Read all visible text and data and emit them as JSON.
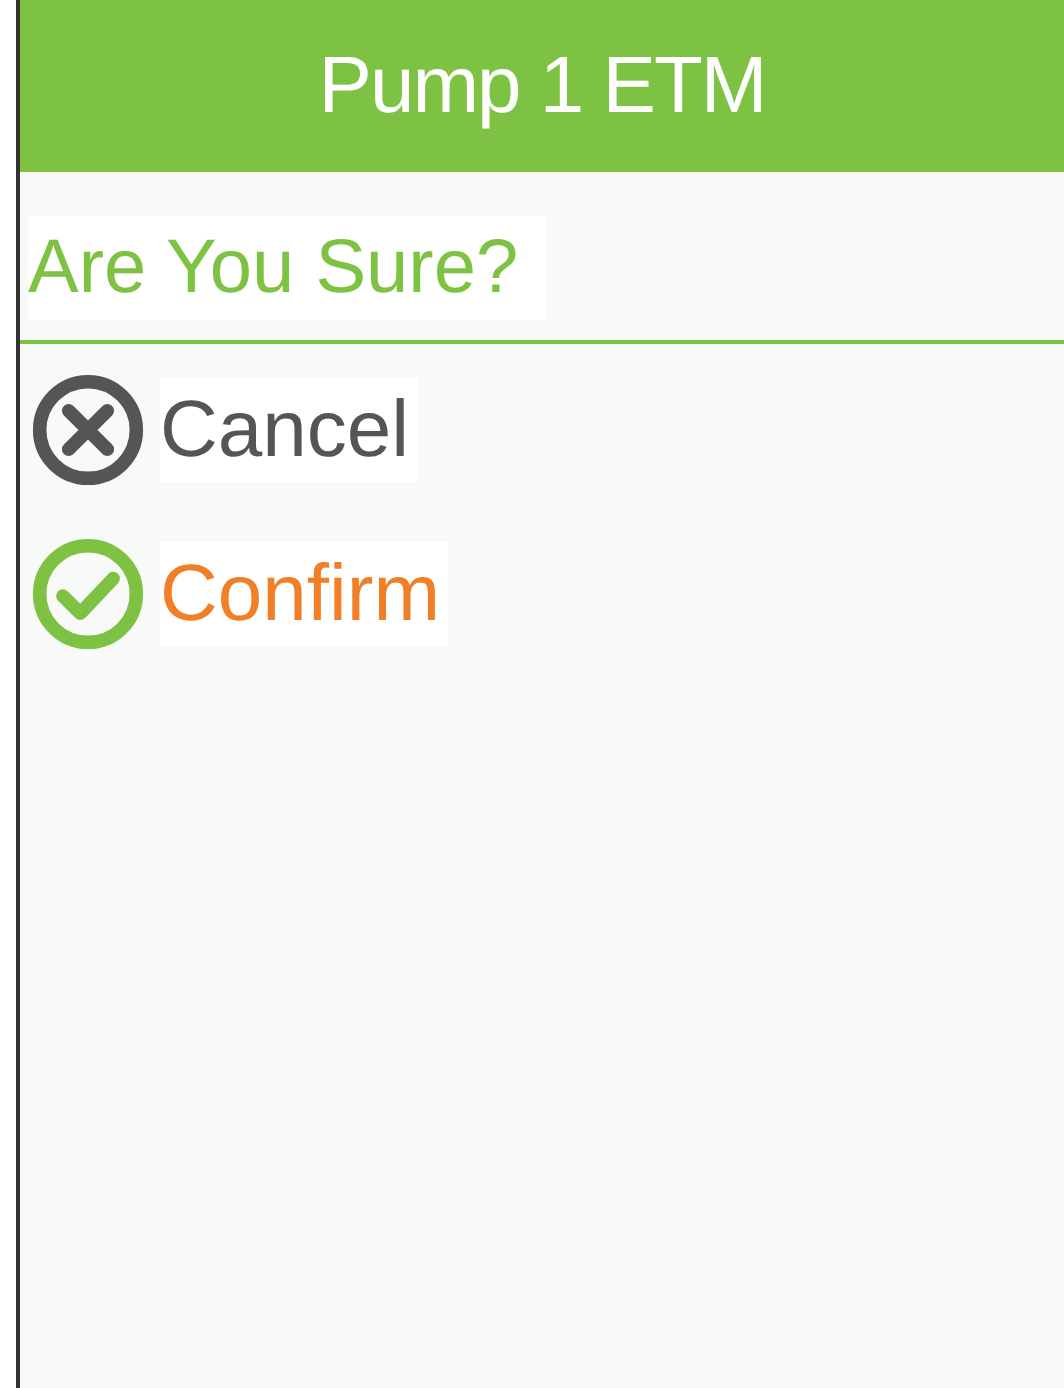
{
  "title": "Pump 1 ETM",
  "prompt": "Are You Sure?",
  "options": [
    {
      "kind": "cancel",
      "label": "Cancel",
      "selected": false
    },
    {
      "kind": "confirm",
      "label": "Confirm",
      "selected": true
    }
  ]
}
